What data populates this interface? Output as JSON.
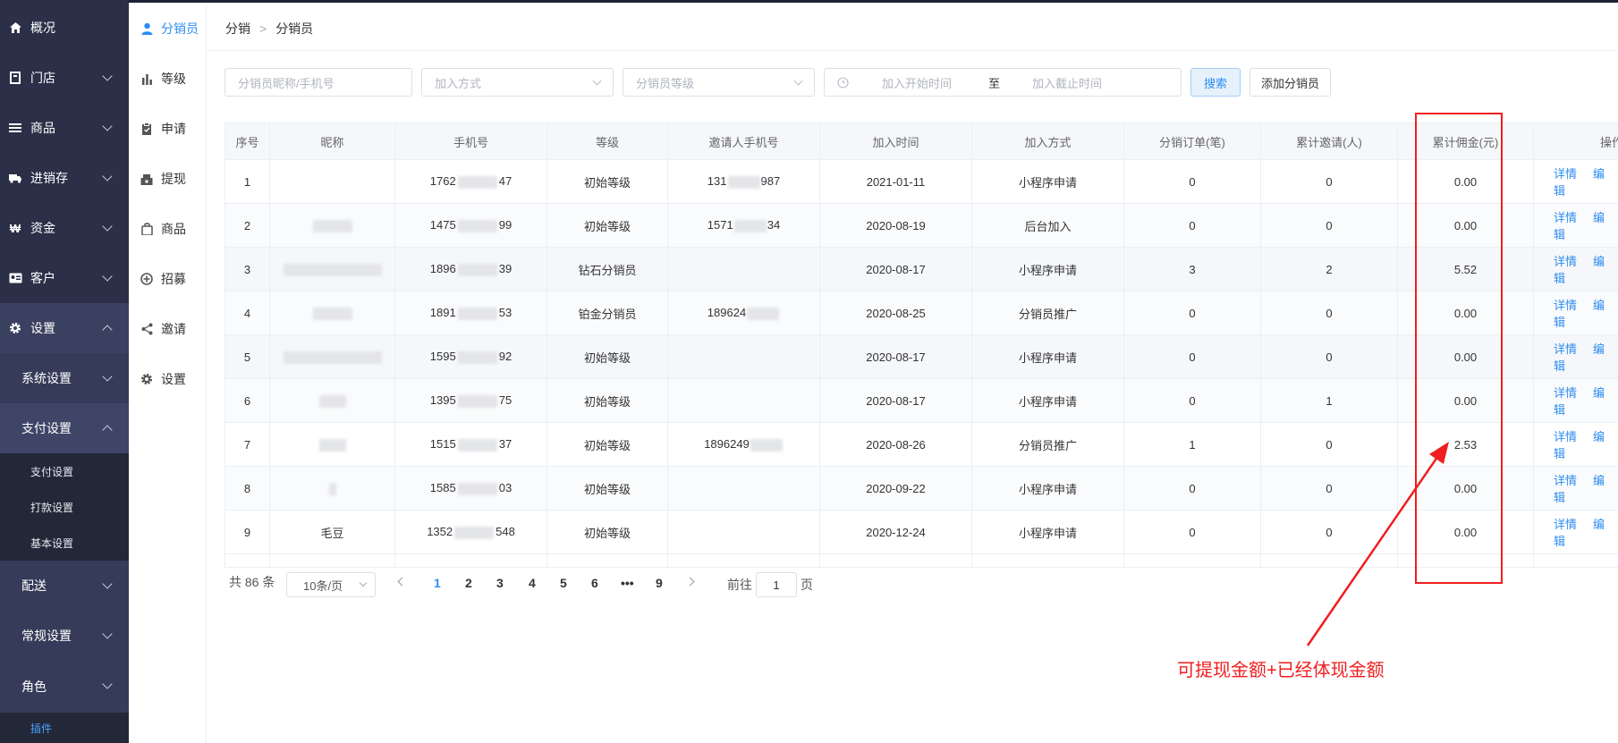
{
  "sidebar": {
    "items": [
      {
        "label": "概况",
        "icon": "home-icon"
      },
      {
        "label": "门店",
        "icon": "store-icon"
      },
      {
        "label": "商品",
        "icon": "list-icon"
      },
      {
        "label": "进销存",
        "icon": "truck-icon"
      },
      {
        "label": "资金",
        "icon": "won-icon"
      },
      {
        "label": "客户",
        "icon": "id-card-icon"
      },
      {
        "label": "设置",
        "icon": "gear-icon"
      }
    ],
    "settings_sub": [
      {
        "label": "系统设置"
      },
      {
        "label": "支付设置"
      }
    ],
    "pay_sub": [
      "支付设置",
      "打款设置",
      "基本设置"
    ],
    "more": [
      {
        "label": "配送"
      },
      {
        "label": "常规设置"
      },
      {
        "label": "角色"
      }
    ],
    "plugin_label": "插件"
  },
  "submenu": [
    {
      "label": "分销员",
      "icon": "user-icon",
      "active": true
    },
    {
      "label": "等级",
      "icon": "bar-chart-icon"
    },
    {
      "label": "申请",
      "icon": "clipboard-icon"
    },
    {
      "label": "提现",
      "icon": "withdraw-icon"
    },
    {
      "label": "商品",
      "icon": "bag-icon"
    },
    {
      "label": "招募",
      "icon": "recruit-icon"
    },
    {
      "label": "邀请",
      "icon": "share-icon"
    },
    {
      "label": "设置",
      "icon": "gear-icon"
    }
  ],
  "breadcrumb": {
    "root": "分销",
    "current": "分销员"
  },
  "filters": {
    "keyword_placeholder": "分销员昵称/手机号",
    "join_method_placeholder": "加入方式",
    "level_placeholder": "分销员等级",
    "start_time_placeholder": "加入开始时间",
    "range_separator": "至",
    "end_time_placeholder": "加入截止时间",
    "search_label": "搜索",
    "add_label": "添加分销员"
  },
  "table": {
    "headers": [
      "序号",
      "昵称",
      "手机号",
      "等级",
      "邀请人手机号",
      "加入时间",
      "加入方式",
      "分销订单(笔)",
      "累计邀请(人)",
      "累计佣金(元)",
      "操作"
    ],
    "rows": [
      {
        "no": "1",
        "nick": "",
        "phone_a": "1762",
        "phone_b": "47",
        "level": "初始等级",
        "inv_a": "131",
        "inv_b": "987",
        "time": "2021-01-11",
        "method": "小程序申请",
        "orders": "0",
        "invites": "0",
        "commission": "0.00"
      },
      {
        "no": "2",
        "nick": "",
        "phone_a": "1475",
        "phone_b": "99",
        "level": "初始等级",
        "inv_a": "1571",
        "inv_b": "34",
        "time": "2020-08-19",
        "method": "后台加入",
        "orders": "0",
        "invites": "0",
        "commission": "0.00"
      },
      {
        "no": "3",
        "nick": "",
        "phone_a": "1896",
        "phone_b": "39",
        "level": "钻石分销员",
        "inv_a": "",
        "inv_b": "",
        "time": "2020-08-17",
        "method": "小程序申请",
        "orders": "3",
        "invites": "2",
        "commission": "5.52"
      },
      {
        "no": "4",
        "nick": "",
        "phone_a": "1891",
        "phone_b": "53",
        "level": "铂金分销员",
        "inv_a": "189624",
        "inv_b": "",
        "time": "2020-08-25",
        "method": "分销员推广",
        "orders": "0",
        "invites": "0",
        "commission": "0.00"
      },
      {
        "no": "5",
        "nick": "",
        "phone_a": "1595",
        "phone_b": "92",
        "level": "初始等级",
        "inv_a": "",
        "inv_b": "",
        "time": "2020-08-17",
        "method": "小程序申请",
        "orders": "0",
        "invites": "0",
        "commission": "0.00"
      },
      {
        "no": "6",
        "nick": "",
        "phone_a": "1395",
        "phone_b": "75",
        "level": "初始等级",
        "inv_a": "",
        "inv_b": "",
        "time": "2020-08-17",
        "method": "小程序申请",
        "orders": "0",
        "invites": "1",
        "commission": "0.00"
      },
      {
        "no": "7",
        "nick": "",
        "phone_a": "1515",
        "phone_b": "37",
        "level": "初始等级",
        "inv_a": "1896249",
        "inv_b": "",
        "time": "2020-08-26",
        "method": "分销员推广",
        "orders": "1",
        "invites": "0",
        "commission": "2.53"
      },
      {
        "no": "8",
        "nick": "",
        "phone_a": "1585",
        "phone_b": "03",
        "level": "初始等级",
        "inv_a": "",
        "inv_b": "",
        "time": "2020-09-22",
        "method": "小程序申请",
        "orders": "0",
        "invites": "0",
        "commission": "0.00"
      },
      {
        "no": "9",
        "nick": "毛豆",
        "phone_a": "1352",
        "phone_b": "548",
        "level": "初始等级",
        "inv_a": "",
        "inv_b": "",
        "time": "2020-12-24",
        "method": "小程序申请",
        "orders": "0",
        "invites": "0",
        "commission": "0.00"
      }
    ],
    "detail_label": "详情",
    "edit_label": "编辑"
  },
  "pagination": {
    "total": "共 86 条",
    "page_size": "10条/页",
    "pages": [
      "1",
      "2",
      "3",
      "4",
      "5",
      "6",
      "•••",
      "9"
    ],
    "current": "1",
    "goto_prefix": "前往",
    "goto_value": "1",
    "goto_suffix": "页"
  },
  "annotation": {
    "text": "可提现金额+已经体现金额",
    "color": "#f01e1e"
  },
  "colors": {
    "sidebar_bg": "#2b3048",
    "accent": "#2d8cf0"
  }
}
